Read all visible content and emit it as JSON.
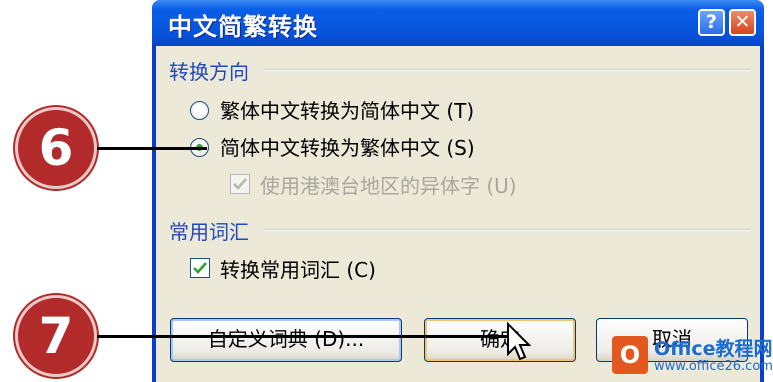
{
  "dialog": {
    "title": "中文简繁转换",
    "help_glyph": "?",
    "close_glyph": "✕"
  },
  "direction_group": {
    "label": "转换方向",
    "options": [
      {
        "label": "繁体中文转换为简体中文 (T)",
        "selected": false
      },
      {
        "label": "简体中文转换为繁体中文 (S)",
        "selected": true
      }
    ],
    "hk_checkbox": {
      "label": "使用港澳台地区的异体字 (U)",
      "checked": true,
      "enabled": false
    }
  },
  "vocab_group": {
    "label": "常用词汇",
    "checkbox": {
      "label": "转换常用词汇 (C)",
      "checked": true
    }
  },
  "buttons": {
    "custom_dict": "自定义词典 (D)...",
    "ok": "确定",
    "cancel": "取消"
  },
  "markers": [
    "6",
    "7"
  ],
  "watermark": {
    "logo_letter": "O",
    "line1": "Office教程网",
    "line2": "www.office26.com"
  },
  "colors": {
    "titlebar": "#0854dc",
    "group_label": "#2049c0",
    "marker": "#b22a2a",
    "check": "#2fa32f"
  }
}
